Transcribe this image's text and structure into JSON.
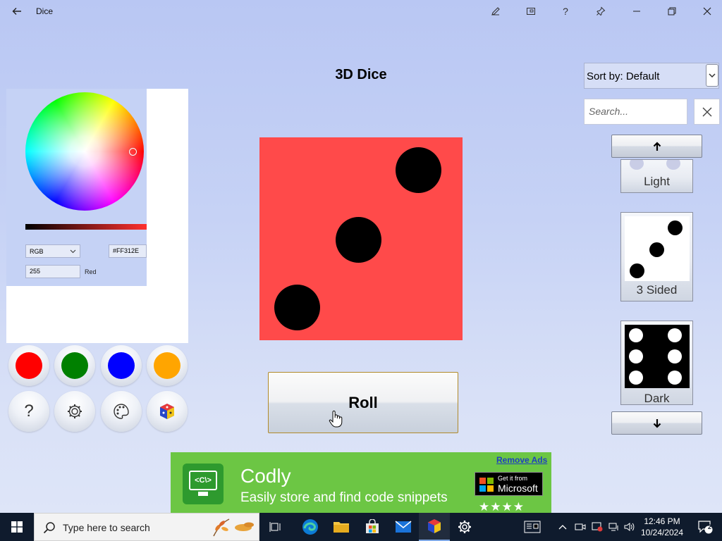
{
  "window": {
    "title": "Dice"
  },
  "titlebar_buttons": [
    "back-icon",
    "pen-icon",
    "compact-overlay-icon",
    "help-icon",
    "pin-icon",
    "minimize-icon",
    "restore-icon",
    "close-icon"
  ],
  "color_picker": {
    "mode": "RGB",
    "hex": "#FF312E",
    "channel_value": "255",
    "channel_label": "Red",
    "swatches": [
      "#ff0000",
      "#008000",
      "#0000ff",
      "#ffa500"
    ]
  },
  "tools": {
    "help_glyph": "?"
  },
  "main": {
    "title": "3D Dice",
    "die_color": "#ff4a4a",
    "die_face": 3,
    "roll_label": "Roll"
  },
  "sidebar": {
    "sort_label": "Sort by: Default",
    "search_placeholder": "Search...",
    "items": [
      {
        "label": "Light"
      },
      {
        "label": "3 Sided"
      },
      {
        "label": "Dark"
      }
    ]
  },
  "ad": {
    "remove_label": "Remove Ads",
    "title": "Codly",
    "subtitle": "Easily store and find code snippets",
    "store_line1": "Get it from",
    "store_line2": "Microsoft",
    "stars": "★★★★",
    "logo_text": "<C\\>"
  },
  "taskbar": {
    "search_placeholder": "Type here to search",
    "time": "12:46 PM",
    "date": "10/24/2024",
    "notification_count": "2"
  }
}
